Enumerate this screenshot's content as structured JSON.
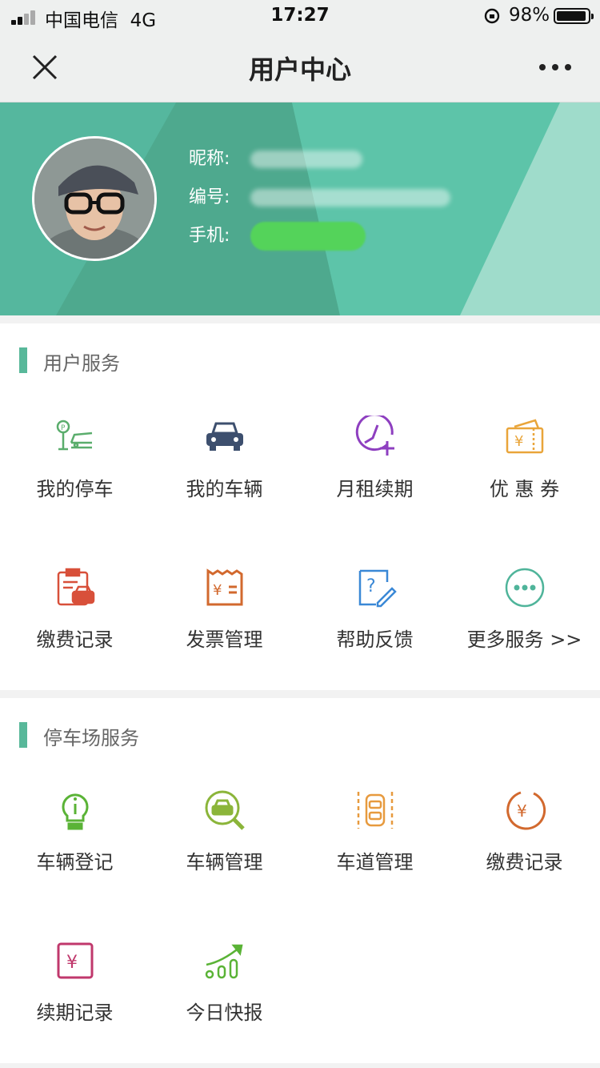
{
  "status_bar": {
    "carrier": "中国电信",
    "network": "4G",
    "time": "17:27",
    "battery": "98%"
  },
  "nav": {
    "title": "用户中心"
  },
  "profile": {
    "nickname_label": "昵称:",
    "id_label": "编号:",
    "phone_label": "手机:"
  },
  "user_services": {
    "title": "用户服务",
    "items": [
      {
        "label": "我的停车",
        "icon": "parking-car-icon",
        "color": "#5aad6c"
      },
      {
        "label": "我的车辆",
        "icon": "car-icon",
        "color": "#3d4f6e"
      },
      {
        "label": "月租续期",
        "icon": "clock-plus-icon",
        "color": "#8e3fc0"
      },
      {
        "label": "优 惠 券",
        "icon": "coupon-icon",
        "color": "#e9a53a"
      },
      {
        "label": "缴费记录",
        "icon": "clipboard-car-icon",
        "color": "#d8503a"
      },
      {
        "label": "发票管理",
        "icon": "invoice-icon",
        "color": "#d2692e"
      },
      {
        "label": "帮助反馈",
        "icon": "help-edit-icon",
        "color": "#3a88d6"
      },
      {
        "label": "更多服务 >>",
        "icon": "more-circle-icon",
        "color": "#4fb49a"
      }
    ]
  },
  "lot_services": {
    "title": "停车场服务",
    "items": [
      {
        "label": "车辆登记",
        "icon": "info-bulb-icon",
        "color": "#5ab336"
      },
      {
        "label": "车辆管理",
        "icon": "car-search-icon",
        "color": "#8bb53a"
      },
      {
        "label": "车道管理",
        "icon": "lane-icon",
        "color": "#e79a3e"
      },
      {
        "label": "缴费记录",
        "icon": "yen-circle-icon",
        "color": "#d2692e"
      },
      {
        "label": "续期记录",
        "icon": "yen-square-icon",
        "color": "#c0386c"
      },
      {
        "label": "今日快报",
        "icon": "trend-icon",
        "color": "#5ab336"
      }
    ]
  }
}
